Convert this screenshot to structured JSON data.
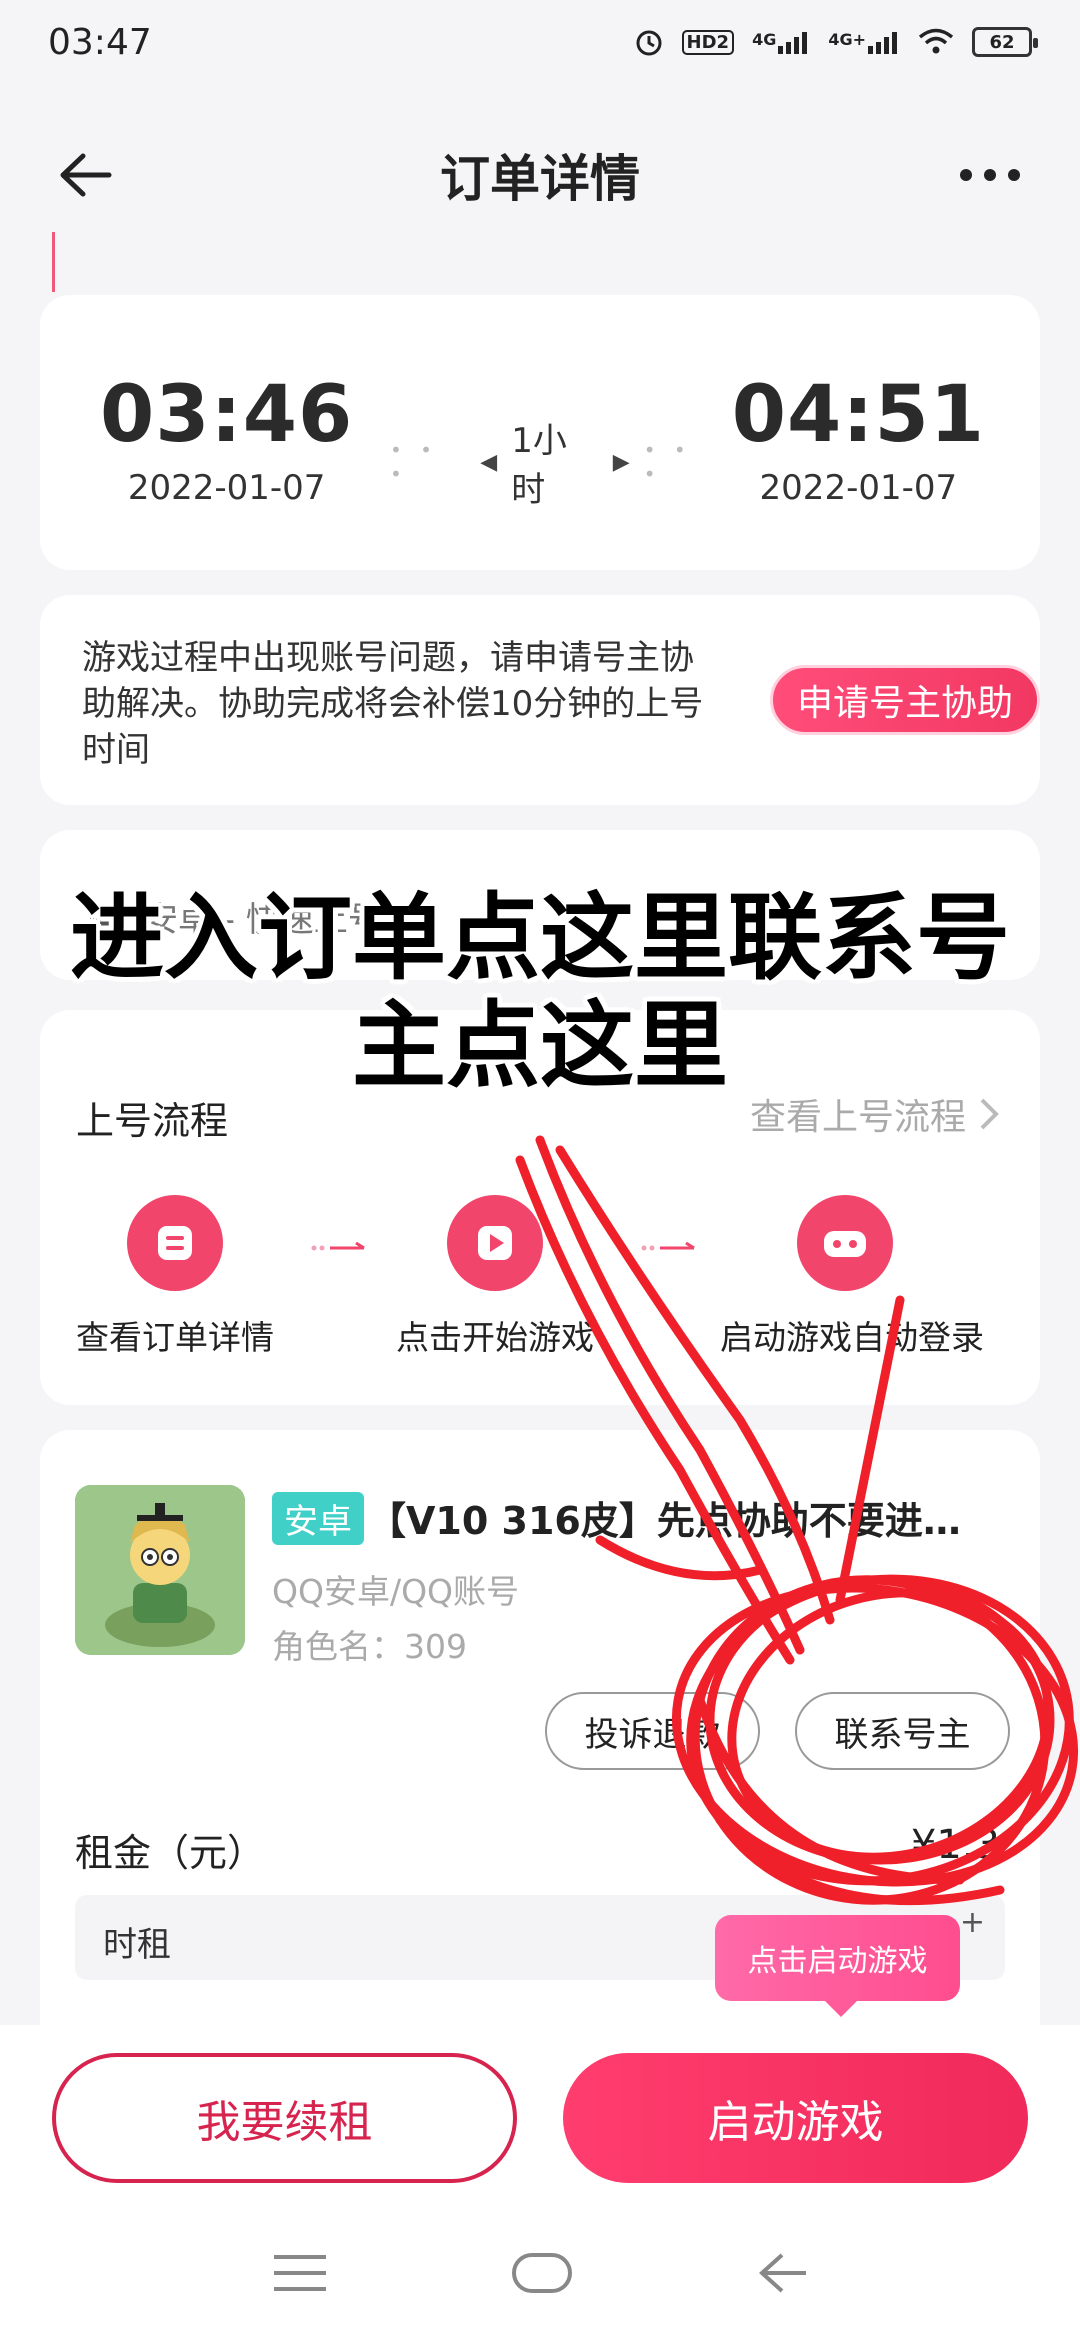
{
  "status_bar": {
    "time": "03:47",
    "icons": [
      "alarm-icon",
      "hd-icon",
      "signal-4g-icon",
      "signal-4g-plus-icon",
      "wifi-icon"
    ],
    "hd_label": "HD2",
    "net1_label": "4G",
    "net2_label": "4G+",
    "battery": "62"
  },
  "nav": {
    "title": "订单详情"
  },
  "rental_time": {
    "start_time": "03:46",
    "start_date": "2022-01-07",
    "duration": "1小时",
    "end_time": "04:51",
    "end_date": "2022-01-07"
  },
  "assist": {
    "text": "游戏过程中出现账号问题，请申请号主协助解决。协助完成将会补偿10分钟的上号时间",
    "button_label": "申请号主协助"
  },
  "platform": {
    "label": "安卓 - 快速上号"
  },
  "flow": {
    "title": "上号流程",
    "link_label": "查看上号流程",
    "steps": [
      {
        "label": "查看订单详情"
      },
      {
        "label": "点击开始游戏"
      },
      {
        "label": "启动游戏自动登录"
      }
    ]
  },
  "game": {
    "tag": "安卓",
    "title": "【V10 316皮】先点协助不要进…",
    "account_type": "QQ安卓/QQ账号",
    "role": "角色名：309",
    "complain_label": "投诉退款",
    "contact_label": "联系号主"
  },
  "rent": {
    "label": "租金（元）",
    "value": "¥1.3",
    "type": "时租",
    "tooltip": "点击启动游戏"
  },
  "bottom": {
    "renew_label": "我要续租",
    "start_label": "启动游戏"
  },
  "overlay": {
    "line1": "进入订单点这里联系号",
    "line2": "主点这里",
    "color": "#000000",
    "annotation_color": "#f0202a"
  },
  "colors": {
    "accent": "#f2456c",
    "tag": "#40d0c8",
    "background": "#f5f5f7"
  }
}
